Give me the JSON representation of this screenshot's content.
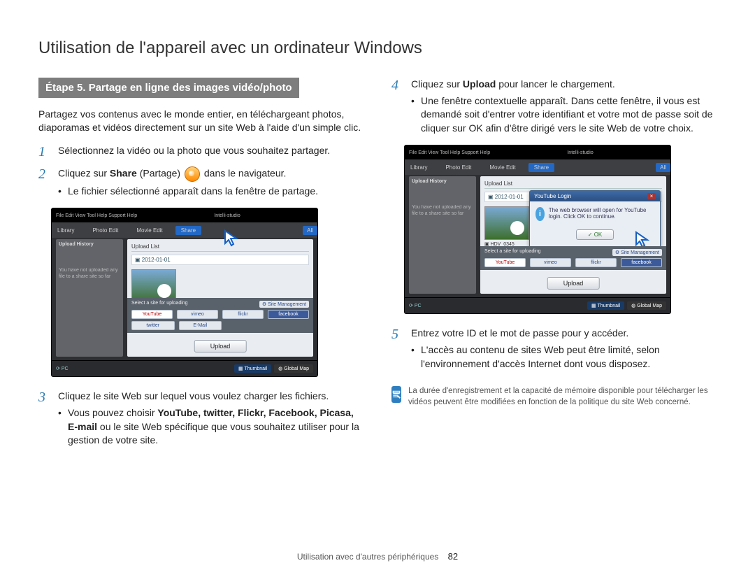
{
  "title": "Utilisation de l'appareil avec un ordinateur Windows",
  "step_banner": "Étape 5. Partage en ligne des images vidéo/photo",
  "intro": "Partagez vos contenus avec le monde entier, en téléchargeant photos, diaporamas et vidéos directement sur un site Web à l'aide d'un simple clic.",
  "left_steps": {
    "s1": "Sélectionnez la vidéo ou la photo que vous souhaitez partager.",
    "s2_pre": "Cliquez sur ",
    "s2_share": "Share",
    "s2_partage": " (Partage) ",
    "s2_post": " dans le navigateur.",
    "s2_sub": "Le fichier sélectionné apparaît dans la fenêtre de partage.",
    "s3": "Cliquez le site Web sur lequel vous voulez charger les fichiers.",
    "s3_sub_pre": "Vous pouvez choisir ",
    "s3_sites": "YouTube, twitter, Flickr, Facebook, Picasa, E-mail",
    "s3_sub_post": " ou le site Web spécifique que vous souhaitez utiliser pour la gestion de votre site."
  },
  "right_steps": {
    "s4_pre": "Cliquez sur ",
    "s4_upload": "Upload",
    "s4_post": " pour lancer le chargement.",
    "s4_sub": "Une fenêtre contextuelle apparaît. Dans cette fenêtre, il vous est demandé soit d'entrer votre identifiant et votre mot de passe soit de cliquer sur OK afin d'être dirigé vers le site Web de votre choix.",
    "s5": "Entrez votre ID et le mot de passe pour y accéder.",
    "s5_sub": "L'accès au contenu de sites Web peut être limité, selon l'environnement d'accès Internet dont vous disposez."
  },
  "note": "La durée d'enregistrement et la capacité de mémoire disponible pour télécharger les vidéos peuvent être modifiées en fonction de la politique du site Web concerné.",
  "screenshot": {
    "app_title": "Intelli-studio",
    "menu": "File  Edit  View  Tool  Help Support  Help",
    "tabs": {
      "library": "Library",
      "photo": "Photo Edit",
      "movie": "Movie Edit",
      "share": "Share",
      "all": "All"
    },
    "left_head": "Upload History",
    "left_note": "You have not uploaded any file to a share site so far",
    "upload_list": "Upload List",
    "date": "2012-01-01",
    "thumb_label": "HDV_0345",
    "sites_head": "Select a site for uploading",
    "site_mgmt": "Site Management",
    "sites": {
      "youtube": "YouTube",
      "vimeo": "vimeo",
      "flickr": "flickr",
      "facebook": "facebook",
      "twitter": "twitter",
      "email": "E-Mail"
    },
    "upload_btn": "Upload",
    "bottom_pc": "PC",
    "bottom_thumb": "Thumbnail",
    "bottom_map": "Global Map",
    "dialog_title": "YouTube Login",
    "dialog_text": "The web browser will open for YouTube login. Click OK to continue.",
    "ok": "OK"
  },
  "footer_section": "Utilisation avec d'autres périphériques",
  "page_number": "82"
}
